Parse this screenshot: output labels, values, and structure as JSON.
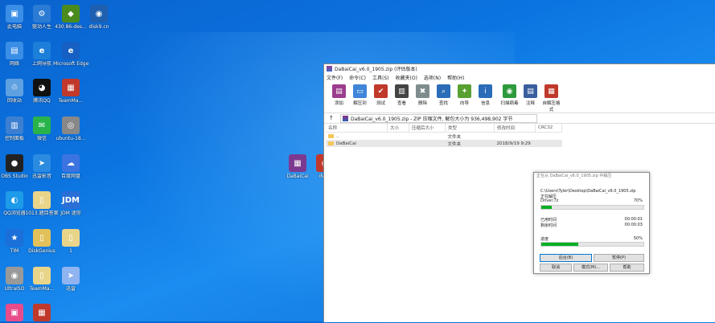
{
  "desktop": {
    "icons": [
      {
        "label": "此电脑",
        "glyph": "▣",
        "color": "#3a8ee6"
      },
      {
        "label": "驱动人生",
        "glyph": "⚙",
        "color": "#2b7bd4"
      },
      {
        "label": "430.86-des...",
        "glyph": "◆",
        "color": "#4b8b1e"
      },
      {
        "label": "disk9.cn",
        "glyph": "◉",
        "color": "#1e5fb0"
      },
      {
        "label": "网络",
        "glyph": "▤",
        "color": "#3a8ee6"
      },
      {
        "label": "上网导航",
        "glyph": "e",
        "color": "#1c7fd9"
      },
      {
        "label": "Microsoft Edge",
        "glyph": "e",
        "color": "#1560c2"
      },
      {
        "label": "回收站",
        "glyph": "♲",
        "color": "#5fa0e0"
      },
      {
        "label": "腾讯QQ",
        "glyph": "◕",
        "color": "#111"
      },
      {
        "label": "TeamMa...",
        "glyph": "▦",
        "color": "#c0392b"
      },
      {
        "label": "控制面板",
        "glyph": "▥",
        "color": "#3c7fd0"
      },
      {
        "label": "微信",
        "glyph": "✉",
        "color": "#28b44a"
      },
      {
        "label": "ubuntu-18...",
        "glyph": "◎",
        "color": "#888"
      },
      {
        "label": "OBS Studio",
        "glyph": "●",
        "color": "#222"
      },
      {
        "label": "迅雷影音",
        "glyph": "➤",
        "color": "#2a8be0"
      },
      {
        "label": "百度网盘",
        "glyph": "☁",
        "color": "#3b73e0"
      },
      {
        "label": "QQ浏览器",
        "glyph": "◐",
        "color": "#1e9be8"
      },
      {
        "label": "1013.题目答案",
        "glyph": "▯",
        "color": "#e9d58a"
      },
      {
        "label": "JDM 迷你",
        "glyph": "JDM",
        "color": "#2a6fd6"
      },
      {
        "label": "TIM",
        "glyph": "★",
        "color": "#1b6fd8"
      },
      {
        "label": "DiskGenius",
        "glyph": "▯",
        "color": "#e2c05a"
      },
      {
        "label": "1",
        "glyph": "▯",
        "color": "#e9d58a"
      },
      {
        "label": "UltraISO",
        "glyph": "◉",
        "color": "#999"
      },
      {
        "label": "TeamMa...",
        "glyph": "▯",
        "color": "#e9d58a"
      },
      {
        "label": "迅雷",
        "glyph": "➤",
        "color": "#8fb4f0"
      },
      {
        "label": "",
        "glyph": "▣",
        "color": "#e84c8b"
      },
      {
        "label": "",
        "glyph": "▦",
        "color": "#c0392b"
      },
      {
        "label": "DaBaiCai",
        "glyph": "▦",
        "color": "#7b3a8f"
      },
      {
        "label": "dv_w",
        "glyph": "◉",
        "color": "#c0392b"
      }
    ]
  },
  "winrar": {
    "title": "DaBaiCai_v6.0_1905.zip (评估版本)",
    "menu": [
      "文件(F)",
      "命令(C)",
      "工具(S)",
      "收藏夹(O)",
      "选项(N)",
      "帮助(H)"
    ],
    "tools": [
      {
        "label": "添加",
        "glyph": "▤",
        "color": "#9b3d8e"
      },
      {
        "label": "解压到",
        "glyph": "▭",
        "color": "#3f86d8"
      },
      {
        "label": "测试",
        "glyph": "✔",
        "color": "#c0392b"
      },
      {
        "label": "查看",
        "glyph": "▥",
        "color": "#444"
      },
      {
        "label": "删除",
        "glyph": "✖",
        "color": "#7f8c8d"
      },
      {
        "label": "查找",
        "glyph": "⌕",
        "color": "#2b6cb8"
      },
      {
        "label": "向导",
        "glyph": "✦",
        "color": "#58a030"
      },
      {
        "label": "信息",
        "glyph": "i",
        "color": "#2b6cb8"
      },
      {
        "label": "扫描病毒",
        "glyph": "◉",
        "color": "#2d9a3b"
      },
      {
        "label": "注释",
        "glyph": "▤",
        "color": "#3a5f9e"
      },
      {
        "label": "自解压格式",
        "glyph": "▦",
        "color": "#c0392b"
      }
    ],
    "address": "DaBaiCai_v6.0_1905.zip - ZIP 压缩文件, 解包大小为 936,498,902 字节",
    "columns": [
      "名称",
      "大小",
      "压缩后大小",
      "类型",
      "修改时间",
      "CRC32"
    ],
    "rows": [
      {
        "name": "..",
        "size": "",
        "packed": "",
        "type": "文件夹",
        "modified": "",
        "crc": ""
      },
      {
        "name": "DaBaiCai",
        "size": "",
        "packed": "",
        "type": "文件夹",
        "modified": "2018/9/19 9:29",
        "crc": ""
      }
    ]
  },
  "progress": {
    "title": "正在从 DaBaiCai_v6.0_1905.zip 中解压",
    "path": "C:\\Users\\Tyler\\Desktop\\DaBaiCai_v6.0_1905.zip",
    "status": "正在解压",
    "file": "Driver.7z",
    "file_percent": "70%",
    "file_fraction": 0.1,
    "elapsed_label": "已用时间",
    "elapsed": "00:00:01",
    "remaining_label": "剩余时间",
    "remaining": "00:00:03",
    "progress_label": "进度",
    "total_percent": "50%",
    "total_fraction": 0.36,
    "buttons": {
      "background": "后台(B)",
      "pause": "暂停(P)",
      "cancel": "取消",
      "mode": "模式(M)...",
      "help": "帮助"
    }
  }
}
